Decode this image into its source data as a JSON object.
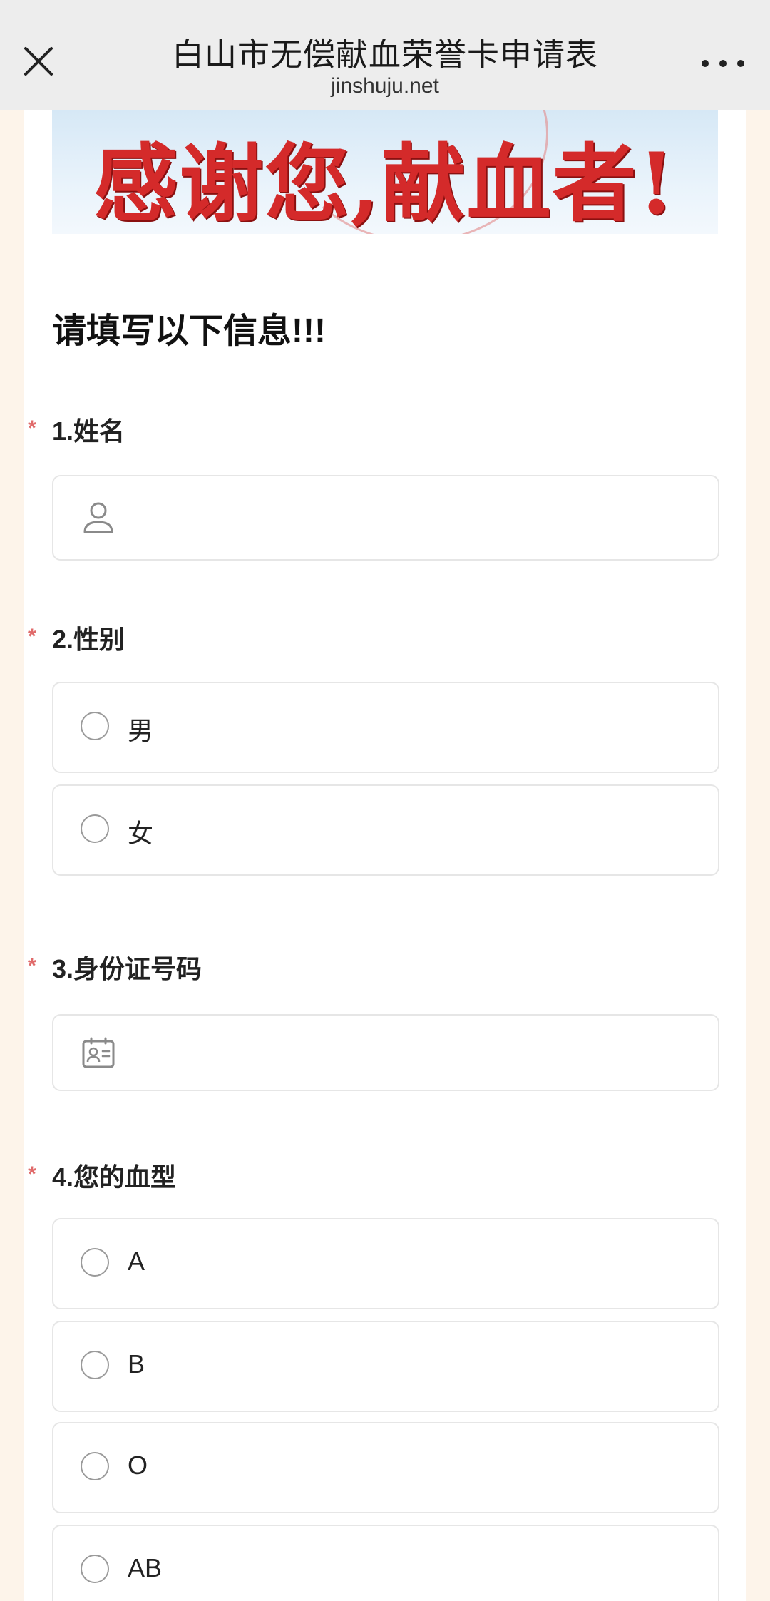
{
  "browser": {
    "title": "白山市无偿献血荣誉卡申请表",
    "domain": "jinshuju.net"
  },
  "banner": {
    "text": "感谢您,献血者!"
  },
  "form": {
    "intro": "请填写以下信息!!!",
    "required_mark": "*",
    "questions": [
      {
        "label": "1.姓名",
        "type": "text",
        "icon": "person-icon"
      },
      {
        "label": "2.性别",
        "type": "radio",
        "options": [
          "男",
          "女"
        ]
      },
      {
        "label": "3.身份证号码",
        "type": "text",
        "icon": "id-card-icon"
      },
      {
        "label": "4.您的血型",
        "type": "radio",
        "options": [
          "A",
          "B",
          "O",
          "AB"
        ]
      }
    ]
  },
  "colors": {
    "accent_red": "#d42a2a",
    "required": "#e06a6a",
    "bar_bg": "#ededed"
  }
}
